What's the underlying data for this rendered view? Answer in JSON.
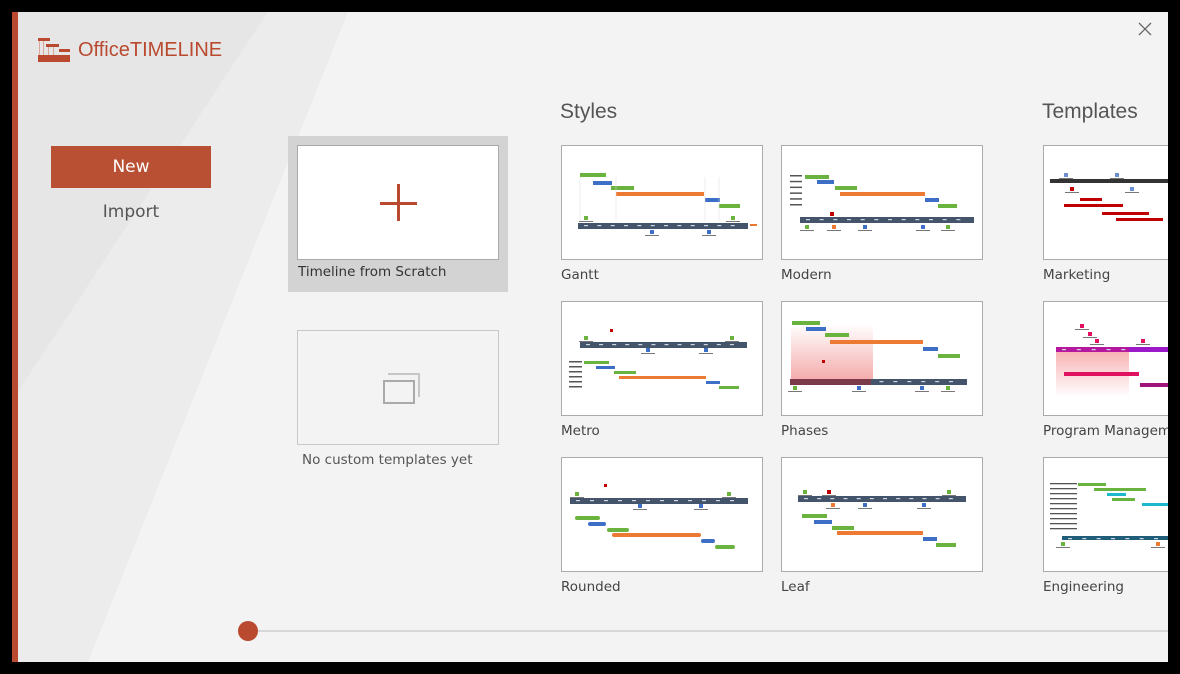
{
  "app": {
    "brand_office": "Office",
    "brand_timeline": "TIMELINE",
    "accent_color": "#b94a2f"
  },
  "window": {
    "close_icon": "close-icon"
  },
  "nav": {
    "items": [
      {
        "label": "New",
        "active": true
      },
      {
        "label": "Import",
        "active": false
      }
    ]
  },
  "scratch": {
    "label": "Timeline from Scratch",
    "icon": "plus-icon"
  },
  "custom": {
    "label": "No custom templates yet",
    "icon": "stacked-windows-icon"
  },
  "styles": {
    "title": "Styles",
    "items": [
      {
        "label": "Gantt"
      },
      {
        "label": "Modern"
      },
      {
        "label": "Metro"
      },
      {
        "label": "Phases"
      },
      {
        "label": "Rounded"
      },
      {
        "label": "Leaf"
      }
    ]
  },
  "templates": {
    "title": "Templates",
    "items": [
      {
        "label": "Marketing"
      },
      {
        "label": "Program Management"
      },
      {
        "label": "Engineering"
      }
    ]
  },
  "pager": {
    "position": 0
  }
}
